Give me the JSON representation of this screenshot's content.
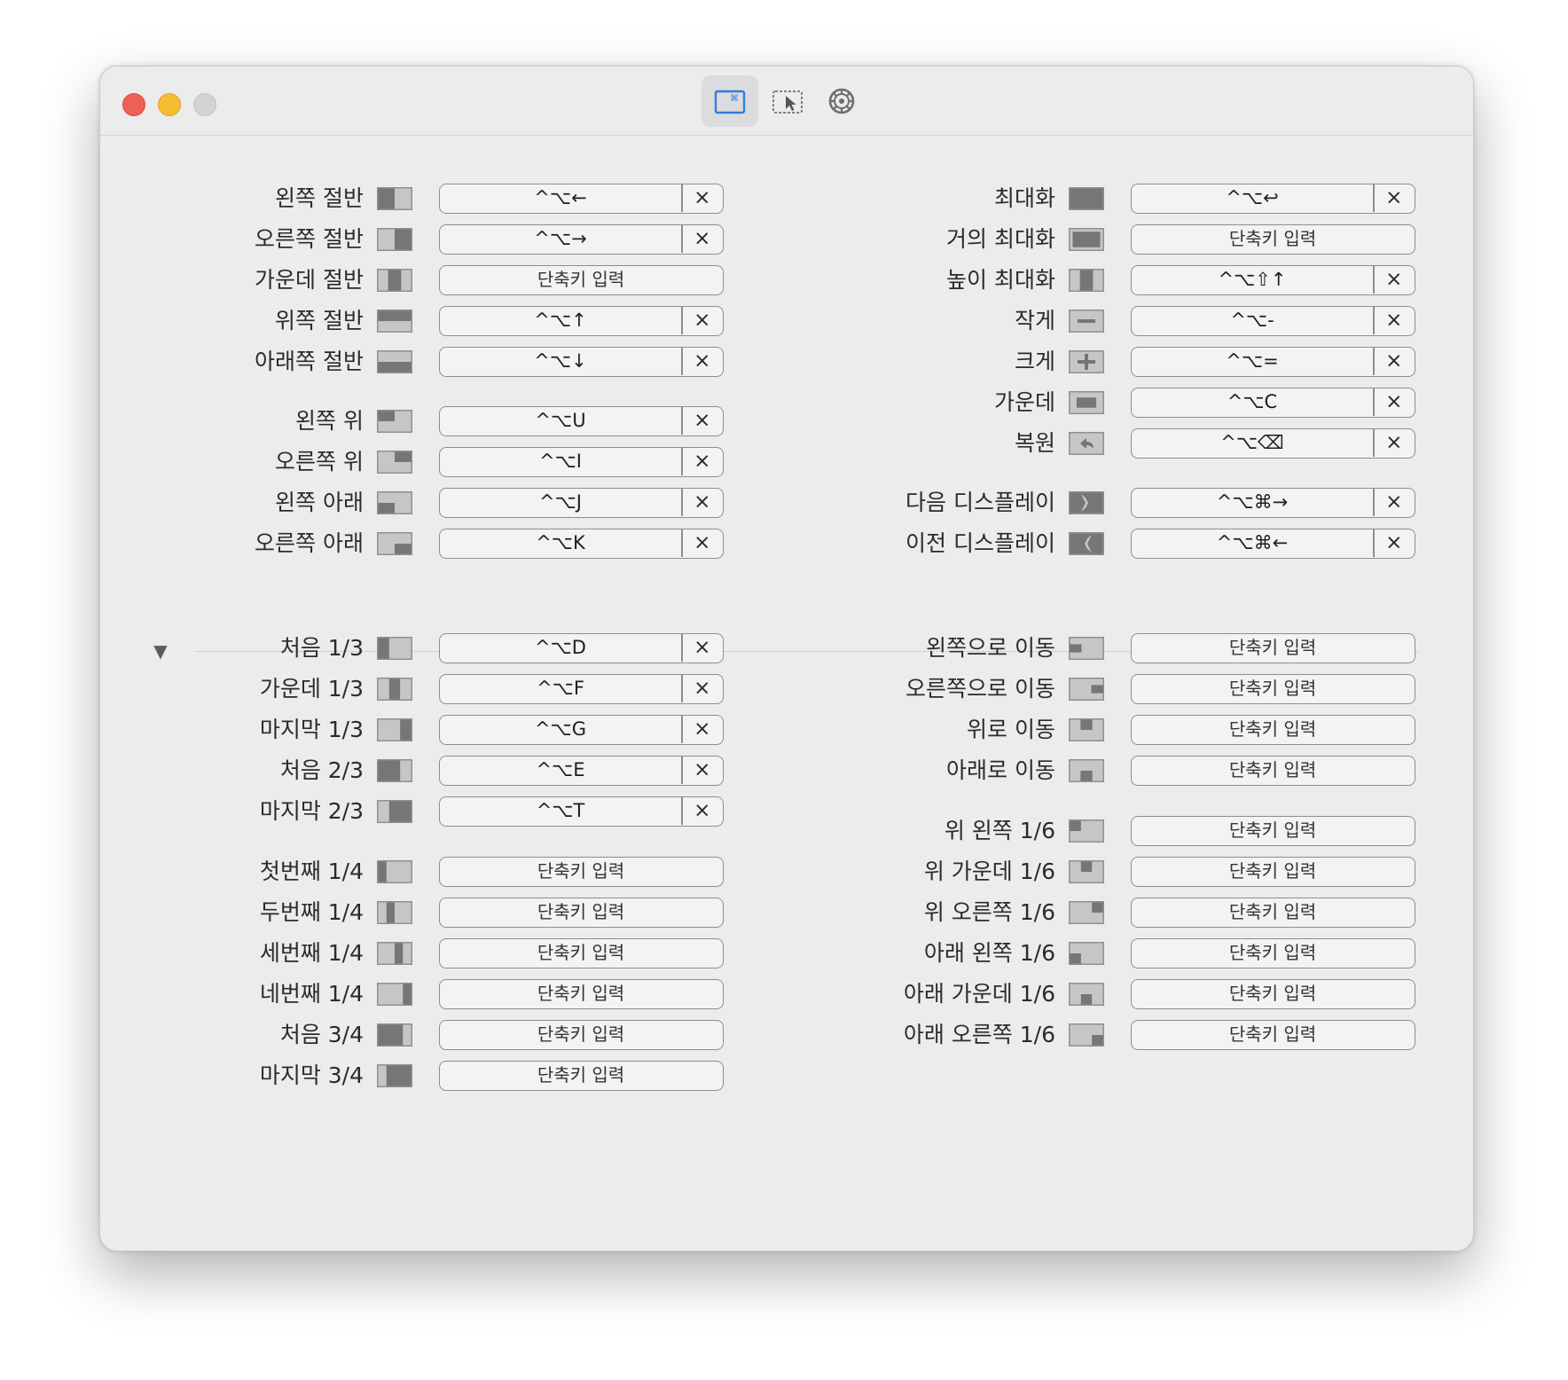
{
  "toolbar": {
    "tabs": [
      {
        "name": "keyboard-shortcuts-tab-icon",
        "active": true
      },
      {
        "name": "snap-areas-tab-icon",
        "active": false
      },
      {
        "name": "settings-tab-icon",
        "active": false
      }
    ]
  },
  "placeholder": "단축키 입력",
  "clear_glyph": "×",
  "disclosure_glyph": "▼",
  "left_col": [
    {
      "label": "왼쪽 절반",
      "icon": "left-half-icon",
      "shortcut": "^⌥←"
    },
    {
      "label": "오른쪽 절반",
      "icon": "right-half-icon",
      "shortcut": "^⌥→"
    },
    {
      "label": "가운데 절반",
      "icon": "center-half-icon",
      "shortcut": ""
    },
    {
      "label": "위쪽 절반",
      "icon": "top-half-icon",
      "shortcut": "^⌥↑"
    },
    {
      "label": "아래쪽 절반",
      "icon": "bottom-half-icon",
      "shortcut": "^⌥↓"
    },
    {
      "label": "왼쪽 위",
      "icon": "top-left-icon",
      "shortcut": "^⌥U"
    },
    {
      "label": "오른쪽 위",
      "icon": "top-right-icon",
      "shortcut": "^⌥I"
    },
    {
      "label": "왼쪽 아래",
      "icon": "bottom-left-icon",
      "shortcut": "^⌥J"
    },
    {
      "label": "오른쪽 아래",
      "icon": "bottom-right-icon",
      "shortcut": "^⌥K"
    },
    {
      "label": "처음 1/3",
      "icon": "first-third-icon",
      "shortcut": "^⌥D"
    },
    {
      "label": "가운데 1/3",
      "icon": "center-third-icon",
      "shortcut": "^⌥F"
    },
    {
      "label": "마지막 1/3",
      "icon": "last-third-icon",
      "shortcut": "^⌥G"
    },
    {
      "label": "처음 2/3",
      "icon": "first-two-thirds-icon",
      "shortcut": "^⌥E"
    },
    {
      "label": "마지막 2/3",
      "icon": "last-two-thirds-icon",
      "shortcut": "^⌥T"
    },
    {
      "label": "첫번째 1/4",
      "icon": "first-fourth-icon",
      "shortcut": ""
    },
    {
      "label": "두번째 1/4",
      "icon": "second-fourth-icon",
      "shortcut": ""
    },
    {
      "label": "세번째 1/4",
      "icon": "third-fourth-icon",
      "shortcut": ""
    },
    {
      "label": "네번째 1/4",
      "icon": "fourth-fourth-icon",
      "shortcut": ""
    },
    {
      "label": "처음 3/4",
      "icon": "first-three-fourths-icon",
      "shortcut": ""
    },
    {
      "label": "마지막 3/4",
      "icon": "last-three-fourths-icon",
      "shortcut": ""
    }
  ],
  "right_col": [
    {
      "label": "최대화",
      "icon": "maximize-icon",
      "shortcut": "^⌥↩"
    },
    {
      "label": "거의 최대화",
      "icon": "almost-maximize-icon",
      "shortcut": ""
    },
    {
      "label": "높이 최대화",
      "icon": "maximize-height-icon",
      "shortcut": "^⌥⇧↑"
    },
    {
      "label": "작게",
      "icon": "smaller-icon",
      "shortcut": "^⌥-"
    },
    {
      "label": "크게",
      "icon": "larger-icon",
      "shortcut": "^⌥="
    },
    {
      "label": "가운데",
      "icon": "center-icon",
      "shortcut": "^⌥C"
    },
    {
      "label": "복원",
      "icon": "restore-icon",
      "shortcut": "^⌥⌫"
    },
    {
      "label": "다음 디스플레이",
      "icon": "next-display-icon",
      "shortcut": "^⌥⌘→"
    },
    {
      "label": "이전 디스플레이",
      "icon": "previous-display-icon",
      "shortcut": "^⌥⌘←"
    },
    {
      "label": "왼쪽으로 이동",
      "icon": "move-left-icon",
      "shortcut": ""
    },
    {
      "label": "오른쪽으로 이동",
      "icon": "move-right-icon",
      "shortcut": ""
    },
    {
      "label": "위로 이동",
      "icon": "move-up-icon",
      "shortcut": ""
    },
    {
      "label": "아래로 이동",
      "icon": "move-down-icon",
      "shortcut": ""
    },
    {
      "label": "위 왼쪽 1/6",
      "icon": "top-left-sixth-icon",
      "shortcut": ""
    },
    {
      "label": "위 가운데 1/6",
      "icon": "top-center-sixth-icon",
      "shortcut": ""
    },
    {
      "label": "위 오른쪽 1/6",
      "icon": "top-right-sixth-icon",
      "shortcut": ""
    },
    {
      "label": "아래 왼쪽 1/6",
      "icon": "bottom-left-sixth-icon",
      "shortcut": ""
    },
    {
      "label": "아래 가운데 1/6",
      "icon": "bottom-center-sixth-icon",
      "shortcut": ""
    },
    {
      "label": "아래 오른쪽 1/6",
      "icon": "bottom-right-sixth-icon",
      "shortcut": ""
    }
  ]
}
